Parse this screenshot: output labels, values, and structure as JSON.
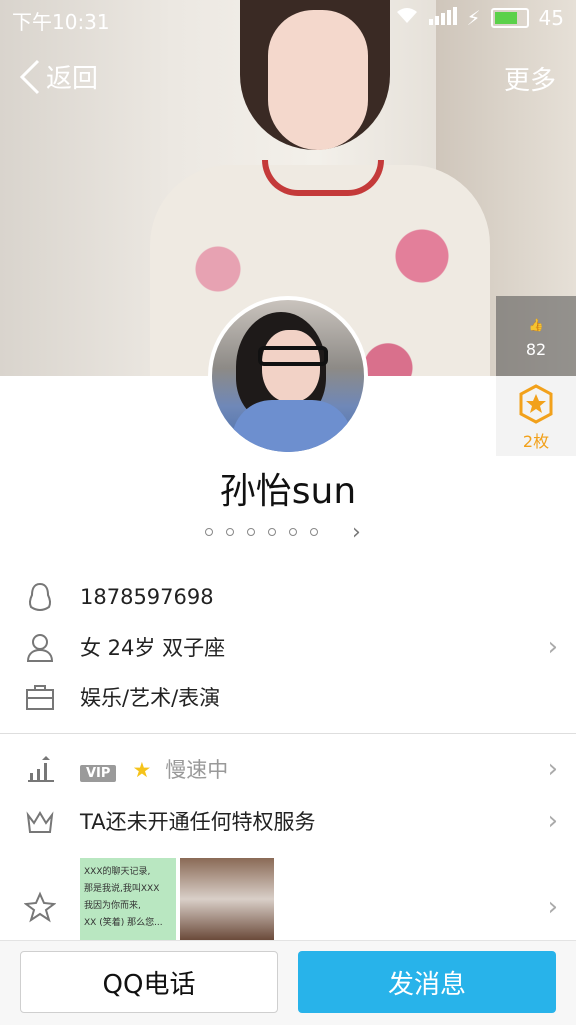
{
  "status_bar": {
    "time": "下午10:31",
    "battery": "45"
  },
  "nav": {
    "back_label": "返回",
    "more_label": "更多"
  },
  "likes": {
    "count": "82"
  },
  "medal": {
    "count_label": "2枚"
  },
  "profile": {
    "name": "孙怡sun",
    "dots_count": 6
  },
  "info": {
    "qq_number": "1878597698",
    "personal": "女  24岁  双子座",
    "occupation": "娱乐/艺术/表演"
  },
  "vip": {
    "badge": "VIP",
    "status": "慢速中"
  },
  "privilege": {
    "text": "TA还未开通任何特权服务"
  },
  "album_note": {
    "lines": [
      "XXX的聊天记录,",
      "那是我说,我叫XXX",
      "我因为你而来,",
      "XX (笑着) 那么您..."
    ]
  },
  "buttons": {
    "call": "QQ电话",
    "message": "发消息"
  },
  "colors": {
    "primary_blue": "#28b3ea",
    "medal_gold": "#f2a11b"
  }
}
